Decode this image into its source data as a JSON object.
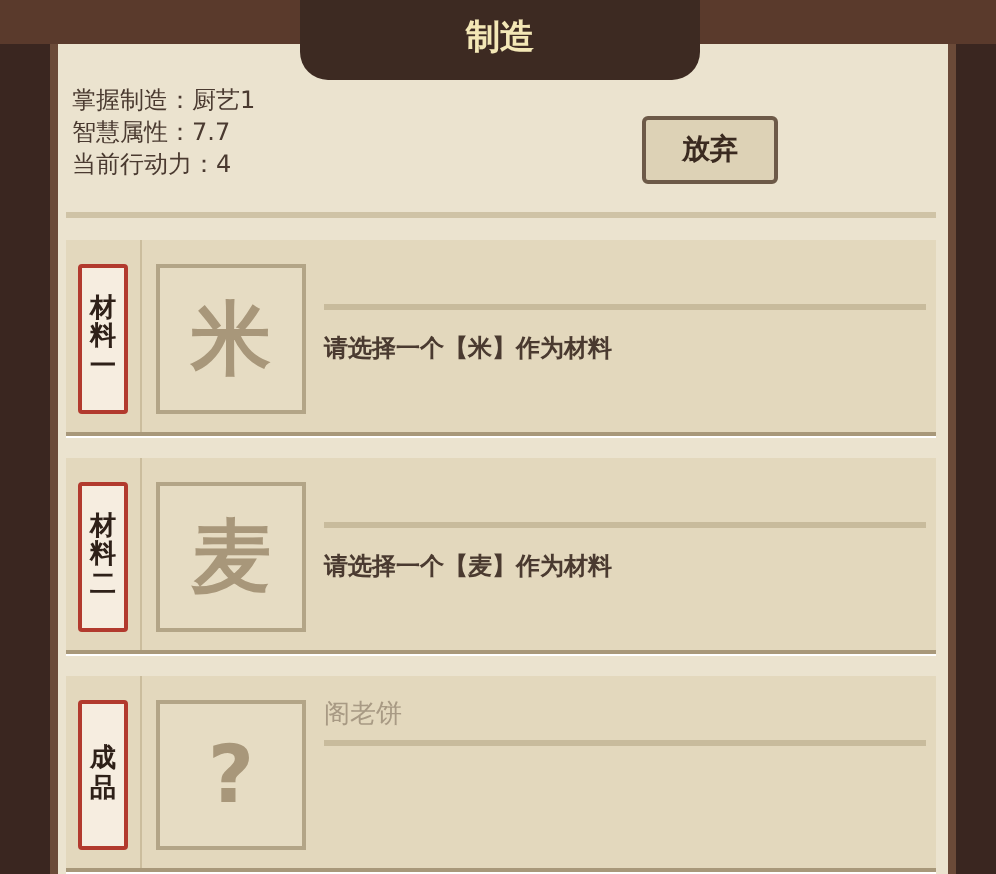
{
  "window": {
    "title": "制造"
  },
  "info": [
    "掌握制造：厨艺1",
    "智慧属性：7.7",
    "当前行动力：4"
  ],
  "abandon_button": "放弃",
  "slots": [
    {
      "kind": "material",
      "tag": "材料一",
      "glyph": "米",
      "prompt": "请选择一个【米】作为材料"
    },
    {
      "kind": "material",
      "tag": "材料二",
      "glyph": "麦",
      "prompt": "请选择一个【麦】作为材料"
    },
    {
      "kind": "product",
      "tag": "成品",
      "glyph": "?",
      "name": "阁老饼"
    }
  ]
}
